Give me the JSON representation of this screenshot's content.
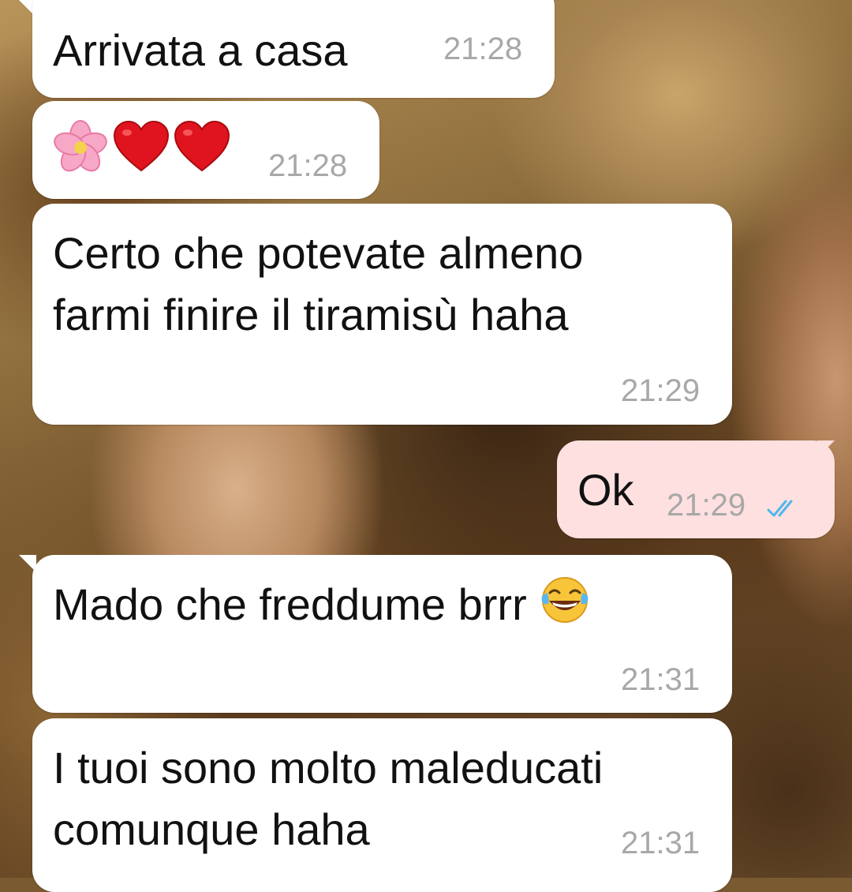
{
  "colors": {
    "incoming_bubble": "#ffffff",
    "outgoing_bubble": "#fde0df",
    "time_text": "#a8a8a8",
    "read_ticks": "#4fb6ec"
  },
  "messages": [
    {
      "direction": "incoming",
      "text": "Arrivata a casa",
      "time": "21:28"
    },
    {
      "direction": "incoming",
      "text": "",
      "emojis": [
        "cherry-blossom-icon",
        "red-heart-icon",
        "red-heart-icon"
      ],
      "time": "21:28"
    },
    {
      "direction": "incoming",
      "text": "Certo che potevate almeno\nfarmi finire il tiramisù haha",
      "time": "21:29"
    },
    {
      "direction": "outgoing",
      "text": "Ok",
      "time": "21:29",
      "status": "read"
    },
    {
      "direction": "incoming",
      "text": "Mado che freddume brrr",
      "emojis": [
        "tears-of-joy-icon"
      ],
      "time": "21:31"
    },
    {
      "direction": "incoming",
      "text": "I tuoi sono molto maleducati\ncomunque haha",
      "time": "21:31"
    }
  ]
}
